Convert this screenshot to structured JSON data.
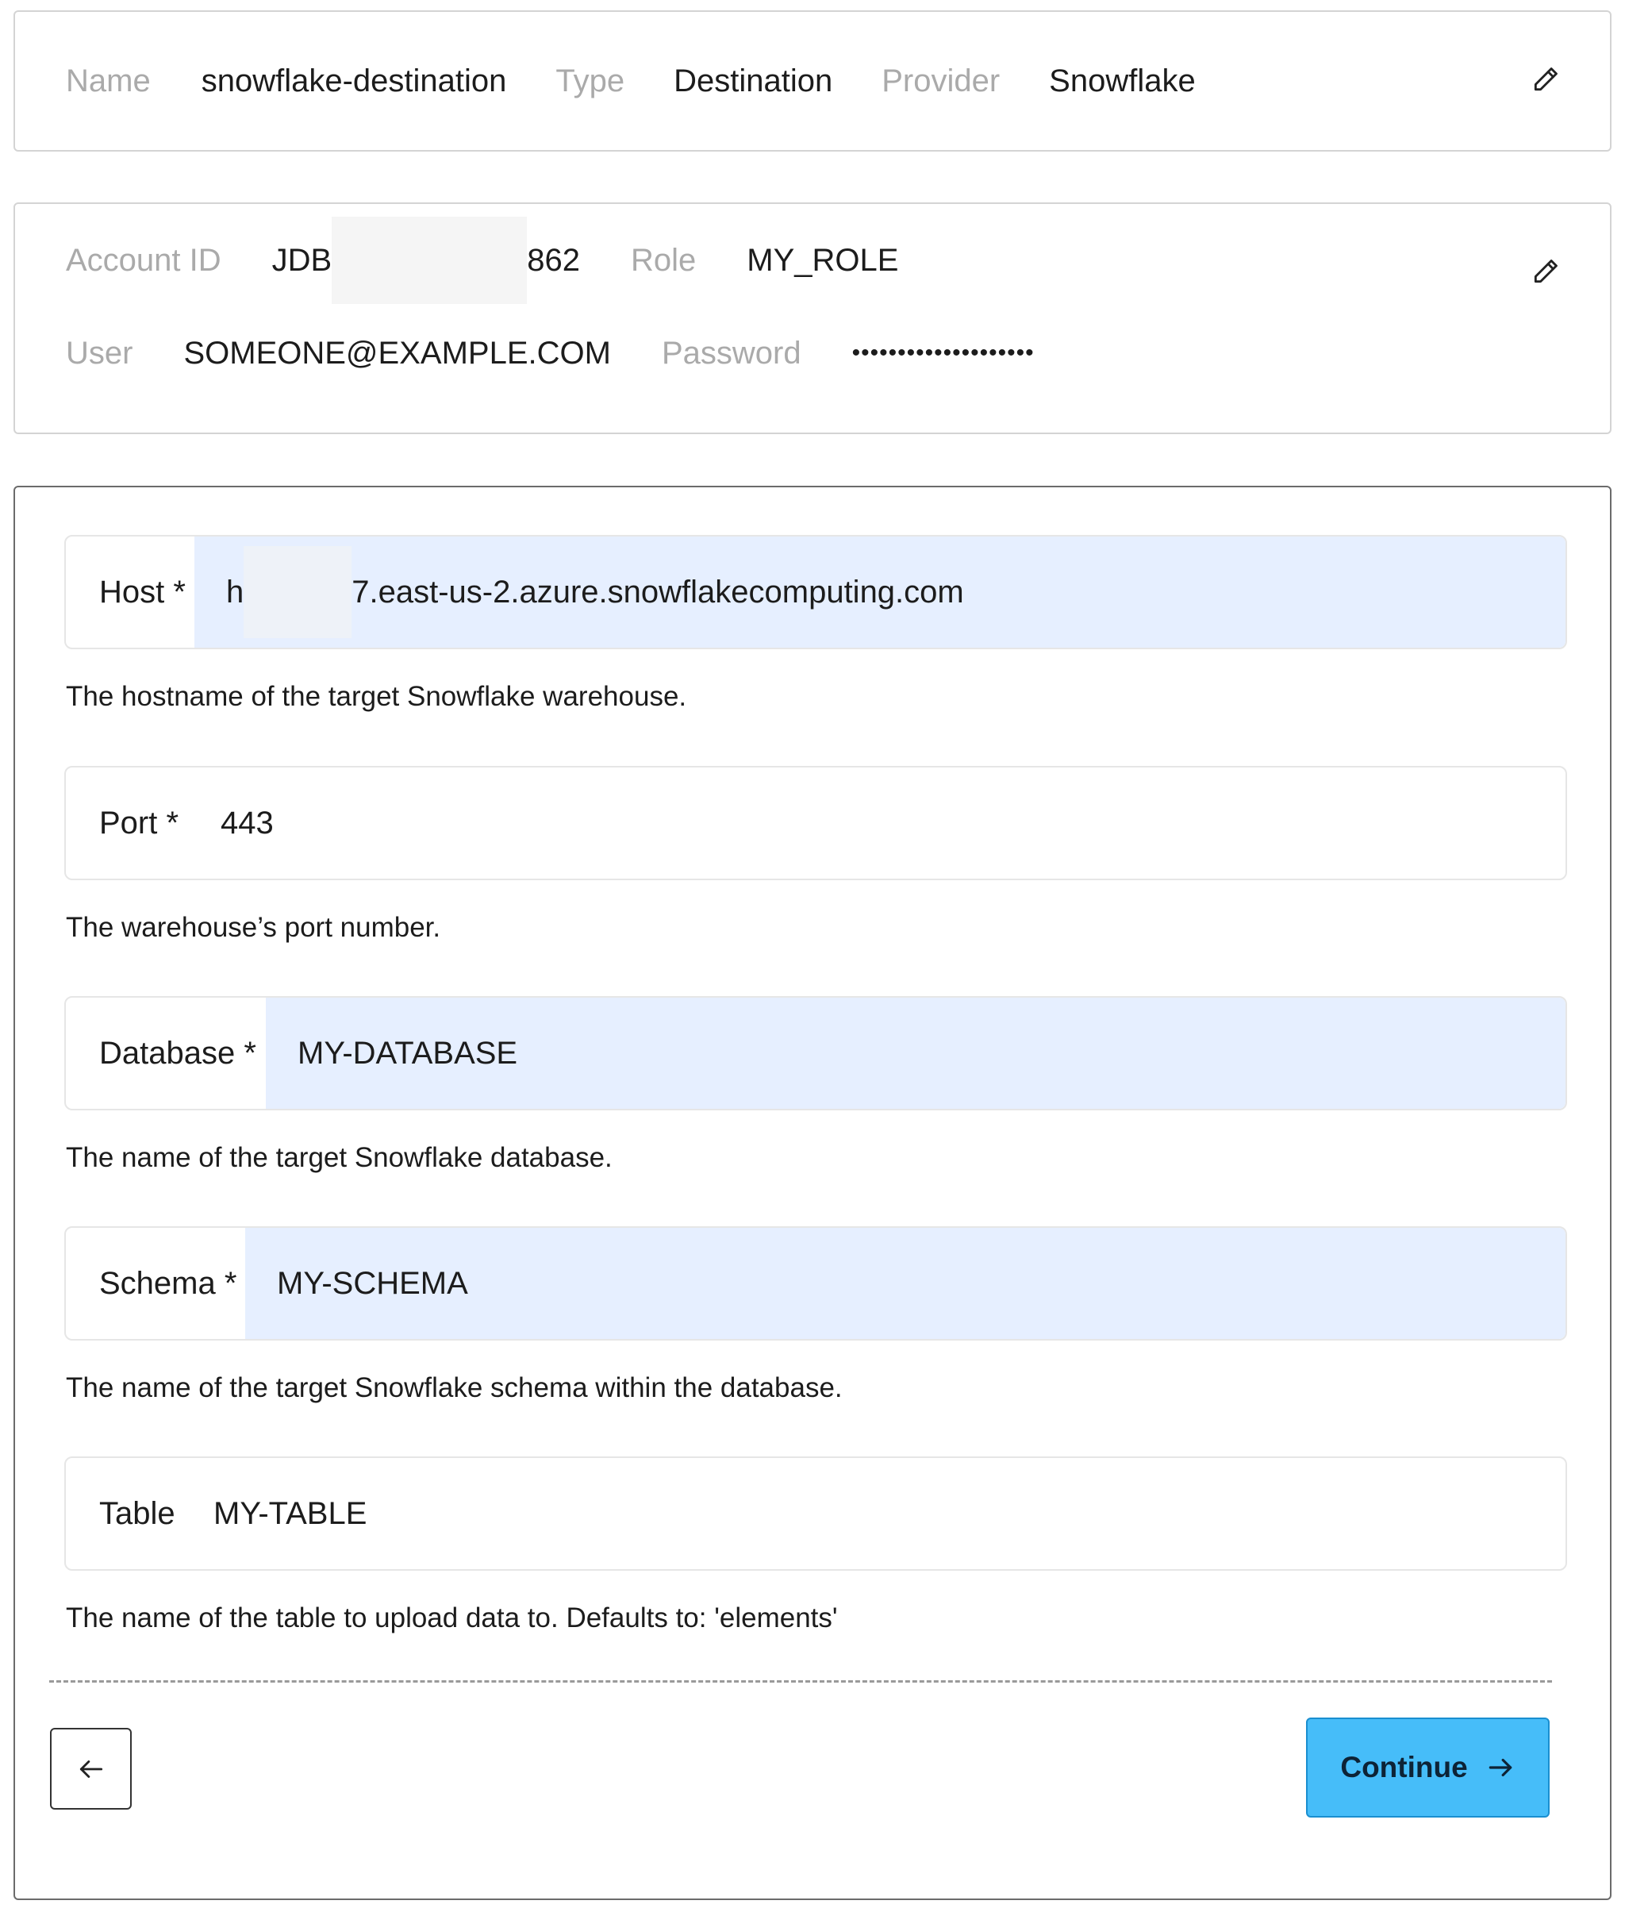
{
  "summary": {
    "name_label": "Name",
    "name_value": "snowflake-destination",
    "type_label": "Type",
    "type_value": "Destination",
    "provider_label": "Provider",
    "provider_value": "Snowflake",
    "edit_icon": "pencil-icon"
  },
  "credentials": {
    "account_label": "Account ID",
    "account_prefix": "JDB",
    "account_suffix": "862",
    "role_label": "Role",
    "role_value": "MY_ROLE",
    "user_label": "User",
    "user_value": "SOMEONE@EXAMPLE.COM",
    "password_label": "Password",
    "password_value": "••••••••••••••••••••",
    "edit_icon": "pencil-icon"
  },
  "form": {
    "host": {
      "label": "Host *",
      "value_prefix": "h",
      "value_suffix": "7.east-us-2.azure.snowflakecomputing.com",
      "help": "The hostname of the target Snowflake warehouse."
    },
    "port": {
      "label": "Port *",
      "value": "443",
      "help": "The warehouse’s port number."
    },
    "database": {
      "label": "Database *",
      "value": "MY-DATABASE",
      "help": "The name of the target Snowflake database."
    },
    "schema": {
      "label": "Schema *",
      "value": "MY-SCHEMA",
      "help": "The name of the target Snowflake schema within the database."
    },
    "table": {
      "label": "Table",
      "value": "MY-TABLE",
      "help": "The name of the table to upload data to. Defaults to: 'elements'"
    }
  },
  "footer": {
    "back_icon": "arrow-left-icon",
    "continue_label": "Continue",
    "continue_icon": "arrow-right-icon"
  },
  "colors": {
    "accent_button": "#46bdf9",
    "autofill_background": "#e6efff",
    "muted_label": "#aaaaaa"
  }
}
